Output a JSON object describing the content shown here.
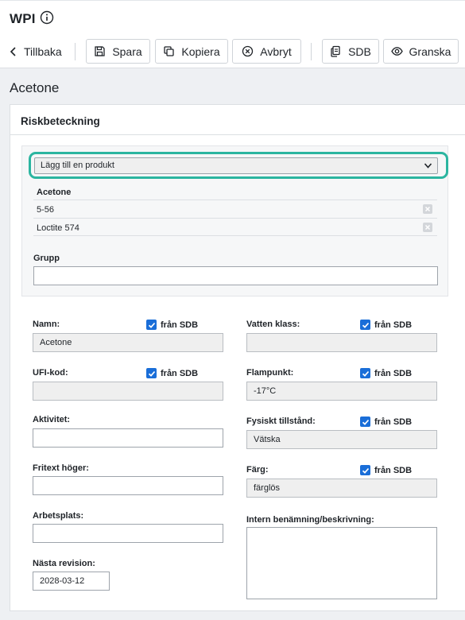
{
  "header": {
    "app_title": "WPI"
  },
  "toolbar": {
    "back_label": "Tillbaka",
    "save_label": "Spara",
    "copy_label": "Kopiera",
    "cancel_label": "Avbryt",
    "sdb_label": "SDB",
    "review_label": "Granska"
  },
  "page_title": "Acetone",
  "card": {
    "title": "Riskbeteckning",
    "product_select": "Lägg till en produkt",
    "product_group_label": "Acetone",
    "products": [
      "5-56",
      "Loctite 574"
    ],
    "group_label": "Grupp",
    "group_value": ""
  },
  "fields": {
    "checkbox_label": "från SDB",
    "name_label": "Namn:",
    "name_value": "Acetone",
    "ufi_label": "UFI-kod:",
    "ufi_value": "",
    "activity_label": "Aktivitet:",
    "activity_value": "",
    "free_text_label": "Fritext höger:",
    "free_text_value": "",
    "workplace_label": "Arbetsplats:",
    "workplace_value": "",
    "next_revision_label": "Nästa revision:",
    "next_revision_value": "2028-03-12",
    "water_class_label": "Vatten klass:",
    "water_class_value": "",
    "flash_point_label": "Flampunkt:",
    "flash_point_value": "-17°C",
    "physical_state_label": "Fysiskt tillstånd:",
    "physical_state_value": "Vätska",
    "color_label": "Färg:",
    "color_value": "färglös",
    "internal_label": "Intern benämning/beskrivning:",
    "internal_value": ""
  },
  "colors": {
    "accent": "#1a6ed8",
    "focus_ring": "#2bb5a0"
  },
  "icons": {
    "info": "info-icon",
    "back": "chevron-left-icon",
    "save": "save-icon",
    "copy": "copy-icon",
    "cancel": "close-circle-icon",
    "sdb": "document-icon",
    "review": "eye-icon",
    "dropdown": "chevron-down-icon",
    "remove": "close-icon",
    "check": "check-icon"
  }
}
